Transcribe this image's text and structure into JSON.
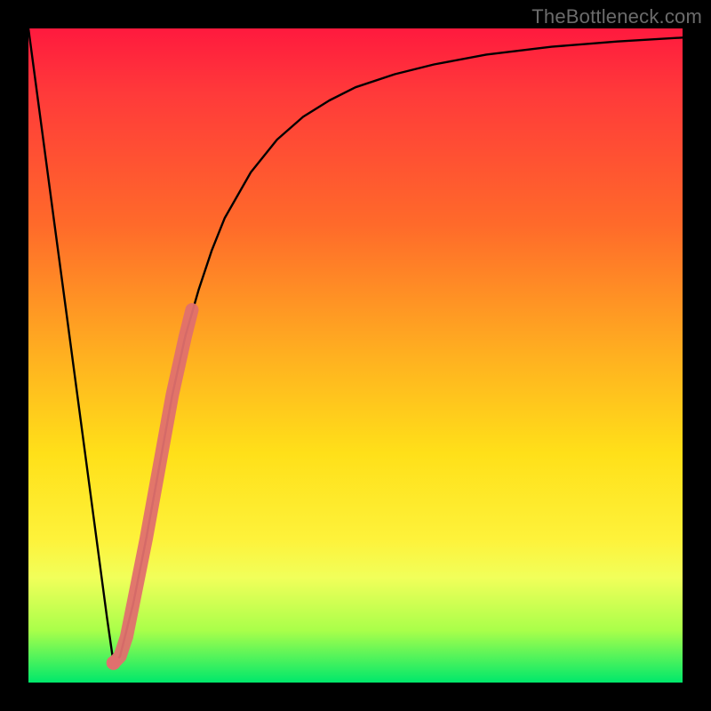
{
  "watermark": {
    "text": "TheBottleneck.com"
  },
  "chart_data": {
    "type": "line",
    "title": "",
    "xlabel": "",
    "ylabel": "",
    "xlim": [
      0,
      100
    ],
    "ylim": [
      0,
      100
    ],
    "series": [
      {
        "name": "bottleneck-curve",
        "x": [
          0,
          2,
          4,
          6,
          8,
          10,
          12,
          13,
          14,
          16,
          18,
          20,
          22,
          24,
          26,
          28,
          30,
          34,
          38,
          42,
          46,
          50,
          56,
          62,
          70,
          80,
          90,
          100
        ],
        "y": [
          100,
          85,
          70,
          55,
          40,
          25,
          10,
          3,
          4,
          12,
          22,
          33,
          44,
          53,
          60,
          66,
          71,
          78,
          83,
          86.5,
          89,
          91,
          93,
          94.5,
          96,
          97.2,
          98,
          98.6
        ]
      }
    ],
    "highlight_segment": {
      "name": "recommended-range",
      "x": [
        13,
        14,
        15,
        16,
        18,
        20,
        22,
        24,
        25
      ],
      "y": [
        3,
        4,
        7,
        12,
        22,
        33,
        44,
        53,
        57
      ]
    }
  }
}
